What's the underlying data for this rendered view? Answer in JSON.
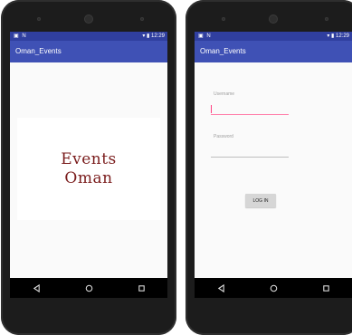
{
  "status_bar": {
    "left_icons": "▣ N",
    "right_text": "▾ ▮ 12:29"
  },
  "app": {
    "title": "Oman_Events"
  },
  "splash": {
    "line1": "Events",
    "line2": "Oman"
  },
  "login": {
    "username_label": "Username",
    "password_label": "Password",
    "username_value": "",
    "password_value": "",
    "button_label": "LOG IN"
  },
  "nav": {
    "icons": [
      "back-icon",
      "home-icon",
      "recents-icon"
    ]
  },
  "colors": {
    "primary": "#3f51b5",
    "primary_dark": "#303f9f",
    "accent": "#ff4081",
    "logo": "#7a1c1c"
  }
}
